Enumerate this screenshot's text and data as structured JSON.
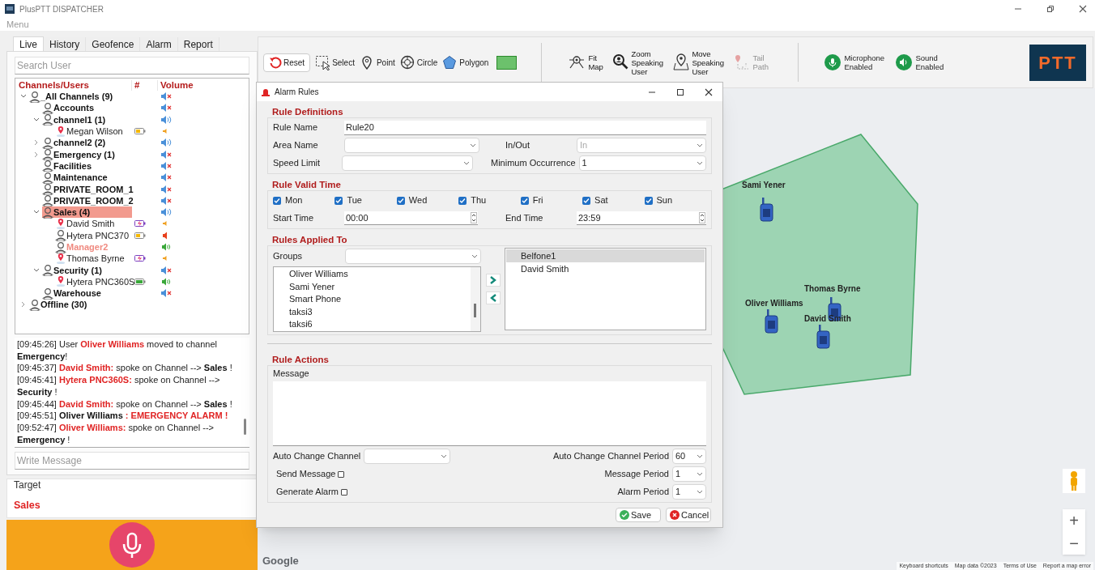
{
  "window": {
    "title": "PlusPTT DISPATCHER"
  },
  "menu": [
    "Menu"
  ],
  "left_panel": {
    "tabs": [
      {
        "label": "Live",
        "selected": true
      },
      {
        "label": "History",
        "selected": false
      },
      {
        "label": "Geofence",
        "selected": false
      },
      {
        "label": "Alarm",
        "selected": false
      },
      {
        "label": "Report",
        "selected": false
      }
    ],
    "search": {
      "placeholder": "Search User"
    },
    "tree": {
      "columns": [
        "Channels/Users",
        "#",
        "Volume"
      ],
      "items": [
        {
          "name": "_All Channels (9)",
          "kind": "channel",
          "expanded": true,
          "selected": false,
          "volume": {
            "kind": "muted"
          },
          "children": [
            {
              "name": "Accounts",
              "kind": "channel",
              "selected": false,
              "volume": {
                "kind": "muted"
              }
            },
            {
              "name": "channel1 (1)",
              "kind": "channel",
              "expanded": true,
              "selected": false,
              "volume": {
                "kind": "on"
              },
              "children": [
                {
                  "name": "Megan Wilson",
                  "kind": "user",
                  "located": true,
                  "highlighted": false,
                  "battery": {
                    "kind": "low"
                  },
                  "selected": false,
                  "volume": {
                    "kind": "low"
                  }
                }
              ]
            },
            {
              "name": "channel2 (2)",
              "kind": "channel",
              "expanded": false,
              "selected": false,
              "volume": {
                "kind": "on"
              }
            },
            {
              "name": "Emergency (1)",
              "kind": "channel",
              "expanded": false,
              "selected": false,
              "volume": {
                "kind": "muted"
              }
            },
            {
              "name": "Facilities",
              "kind": "channel",
              "selected": false,
              "volume": {
                "kind": "muted"
              }
            },
            {
              "name": "Maintenance",
              "kind": "channel",
              "selected": false,
              "volume": {
                "kind": "muted"
              }
            },
            {
              "name": "PRIVATE_ROOM_1",
              "kind": "channel",
              "selected": false,
              "volume": {
                "kind": "muted"
              }
            },
            {
              "name": "PRIVATE_ROOM_2",
              "kind": "channel",
              "selected": false,
              "volume": {
                "kind": "muted"
              }
            },
            {
              "name": "Sales (4)",
              "kind": "channel",
              "expanded": true,
              "selected": true,
              "volume": {
                "kind": "on"
              },
              "children": [
                {
                  "name": "David Smith",
                  "kind": "user",
                  "located": true,
                  "highlighted": false,
                  "battery": {
                    "kind": "charging"
                  },
                  "selected": false,
                  "volume": {
                    "kind": "low"
                  }
                },
                {
                  "name": "Hytera PNC370",
                  "kind": "user",
                  "located": false,
                  "highlighted": false,
                  "battery": {
                    "kind": "low"
                  },
                  "selected": false,
                  "volume": {
                    "kind": "medium"
                  }
                },
                {
                  "name": "Manager2",
                  "kind": "user",
                  "located": false,
                  "highlighted": true,
                  "selected": false,
                  "volume": {
                    "kind": "high"
                  }
                },
                {
                  "name": "Thomas Byrne",
                  "kind": "user",
                  "located": true,
                  "highlighted": false,
                  "battery": {
                    "kind": "charging"
                  },
                  "selected": false,
                  "volume": {
                    "kind": "low"
                  }
                }
              ]
            },
            {
              "name": "Security (1)",
              "kind": "channel",
              "expanded": true,
              "selected": false,
              "volume": {
                "kind": "muted"
              },
              "children": [
                {
                  "name": "Hytera PNC360S",
                  "kind": "user",
                  "located": true,
                  "highlighted": false,
                  "battery": {
                    "kind": "full"
                  },
                  "selected": false,
                  "volume": {
                    "kind": "high"
                  }
                }
              ]
            },
            {
              "name": "Warehouse",
              "kind": "channel",
              "selected": false,
              "volume": {
                "kind": "muted"
              }
            }
          ]
        },
        {
          "name": "Offline (30)",
          "kind": "channel",
          "expanded": false,
          "selected": false
        }
      ]
    },
    "log": [
      {
        "segments": [
          {
            "kind": "plain",
            "text": "[09:45:26] User "
          },
          {
            "kind": "name",
            "text": "Oliver Williams"
          },
          {
            "kind": "plain",
            "text": " moved to channel "
          },
          {
            "kind": "bold",
            "text": "Emergency"
          },
          {
            "kind": "plain",
            "text": "!"
          }
        ]
      },
      {
        "segments": [
          {
            "kind": "plain",
            "text": "[09:45:37] "
          },
          {
            "kind": "name",
            "text": "David Smith:"
          },
          {
            "kind": "plain",
            "text": " spoke on Channel --> "
          },
          {
            "kind": "bold",
            "text": "Sales"
          },
          {
            "kind": "plain",
            "text": " !"
          }
        ]
      },
      {
        "segments": [
          {
            "kind": "plain",
            "text": "[09:45:41] "
          },
          {
            "kind": "name",
            "text": "Hytera PNC360S:"
          },
          {
            "kind": "plain",
            "text": " spoke on Channel --> "
          },
          {
            "kind": "bold",
            "text": "Security"
          },
          {
            "kind": "plain",
            "text": " !"
          }
        ]
      },
      {
        "segments": [
          {
            "kind": "plain",
            "text": "[09:45:44] "
          },
          {
            "kind": "name",
            "text": "David Smith:"
          },
          {
            "kind": "plain",
            "text": " spoke on Channel --> "
          },
          {
            "kind": "bold",
            "text": "Sales"
          },
          {
            "kind": "plain",
            "text": " !"
          }
        ]
      },
      {
        "segments": [
          {
            "kind": "plain",
            "text": "[09:45:51] "
          },
          {
            "kind": "bold",
            "text": "Oliver Williams"
          },
          {
            "kind": "alarm",
            "text": " : EMERGENCY ALARM !"
          }
        ]
      },
      {
        "segments": [
          {
            "kind": "plain",
            "text": "[09:52:47] "
          },
          {
            "kind": "name",
            "text": "Oliver Williams:"
          },
          {
            "kind": "plain",
            "text": " spoke on Channel --> "
          },
          {
            "kind": "bold",
            "text": "Emergency"
          },
          {
            "kind": "plain",
            "text": " !"
          }
        ]
      }
    ],
    "message": {
      "placeholder": "Write Message"
    },
    "target": {
      "title": "Target",
      "value": "Sales"
    }
  },
  "toolbar": {
    "draw_tools": [
      {
        "kind": "reset",
        "label": "Reset"
      },
      {
        "kind": "select",
        "label": "Select"
      },
      {
        "kind": "point",
        "label": "Point"
      },
      {
        "kind": "circle",
        "label": "Circle"
      },
      {
        "kind": "polygon",
        "label": "Polygon"
      },
      {
        "kind": "swatch",
        "color": "#6cc16c"
      }
    ],
    "map_tools": [
      {
        "kind": "fit",
        "label": "Fit Map",
        "disabled": false
      },
      {
        "kind": "zoom",
        "label": "Zoom Speaking User",
        "disabled": false
      },
      {
        "kind": "move",
        "label": "Move Speaking User",
        "disabled": false
      },
      {
        "kind": "tail",
        "label": "Tail Path",
        "disabled": true
      }
    ],
    "toggles": [
      {
        "kind": "microphone",
        "label": "Microphone Enabled",
        "on": true
      },
      {
        "kind": "sound",
        "label": "Sound Enabled",
        "on": true
      }
    ],
    "logo": "PTT"
  },
  "map": {
    "markers": [
      {
        "name": "Sami Yener"
      },
      {
        "name": "Oliver Williams"
      },
      {
        "name": "Thomas Byrne"
      },
      {
        "name": "David Smith"
      }
    ],
    "zoom": [
      "+",
      "−"
    ],
    "google": "Google",
    "attribution": [
      "Keyboard shortcuts",
      "Map data ©2023",
      "Terms of Use",
      "Report a map error"
    ]
  },
  "dialog": {
    "title": "Alarm Rules",
    "definitions": {
      "title": "Rule Definitions",
      "rule_name": {
        "label": "Rule Name",
        "value": "Rule20"
      },
      "area_name": {
        "label": "Area Name"
      },
      "in_out": {
        "label": "In/Out",
        "value": "In",
        "disabled": true
      },
      "speed_limit": {
        "label": "Speed Limit"
      },
      "minimum_occurrence": {
        "label": "Minimum Occurrence",
        "value": "1"
      }
    },
    "valid_time": {
      "title": "Rule Valid Time",
      "days": [
        {
          "label": "Mon",
          "checked": true
        },
        {
          "label": "Tue",
          "checked": true
        },
        {
          "label": "Wed",
          "checked": true
        },
        {
          "label": "Thu",
          "checked": true
        },
        {
          "label": "Fri",
          "checked": true
        },
        {
          "label": "Sat",
          "checked": true
        },
        {
          "label": "Sun",
          "checked": true
        }
      ],
      "start_time": {
        "label": "Start Time",
        "value": "00:00"
      },
      "end_time": {
        "label": "End Time",
        "value": "23:59"
      }
    },
    "applied_to": {
      "title": "Rules Applied To",
      "groups": {
        "label": "Groups"
      },
      "available": [
        "Oliver Williams",
        "Sami Yener",
        "Smart Phone",
        "taksi3",
        "taksi6"
      ],
      "assigned": [
        {
          "label": "Belfone1",
          "selected": true
        },
        {
          "label": "David Smith",
          "selected": false
        }
      ]
    },
    "actions": {
      "title": "Rule Actions",
      "message": {
        "label": "Message"
      },
      "auto_change_channel": {
        "label": "Auto Change Channel"
      },
      "send_message": {
        "label": "Send Message",
        "checked": false
      },
      "generate_alarm": {
        "label": "Generate Alarm",
        "checked": false
      },
      "auto_change_channel_period": {
        "label": "Auto Change Channel Period",
        "value": "60"
      },
      "message_period": {
        "label": "Message Period",
        "value": "1"
      },
      "alarm_period": {
        "label": "Alarm Period",
        "value": "1"
      }
    },
    "buttons": [
      {
        "kind": "save",
        "label": "Save"
      },
      {
        "kind": "cancel",
        "label": "Cancel"
      }
    ]
  }
}
